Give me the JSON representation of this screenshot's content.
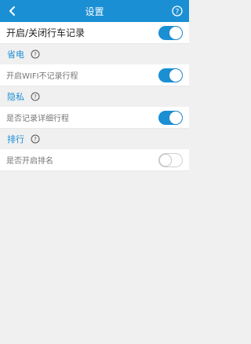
{
  "header": {
    "title": "设置",
    "back_icon": "chevron-left-icon",
    "help_icon": "help-circle-icon"
  },
  "main_toggle": {
    "label": "开启/关闭行车记录",
    "state": "on"
  },
  "sections": [
    {
      "title": "省电",
      "row": {
        "label": "开启WIFI不记录行程",
        "state": "on"
      }
    },
    {
      "title": "隐私",
      "row": {
        "label": "是否记录详细行程",
        "state": "on"
      }
    },
    {
      "title": "排行",
      "row": {
        "label": "是否开启排名",
        "state": "off"
      }
    }
  ],
  "colors": {
    "accent": "#1b8fd4",
    "background": "#f0f0f0"
  }
}
